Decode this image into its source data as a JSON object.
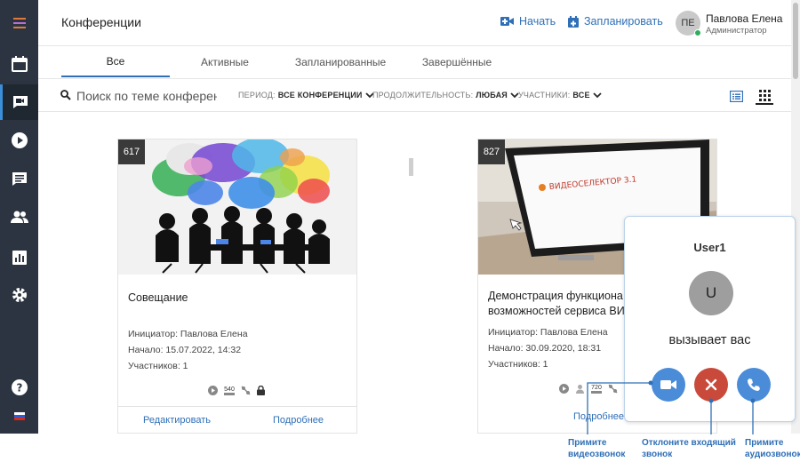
{
  "header": {
    "title": "Конференции",
    "start_label": "Начать",
    "schedule_label": "Запланировать",
    "user": {
      "initials": "ПЕ",
      "name": "Павлова Елена",
      "role": "Администратор"
    }
  },
  "tabs": [
    {
      "label": "Все",
      "active": true
    },
    {
      "label": "Активные"
    },
    {
      "label": "Запланированные"
    },
    {
      "label": "Завершённые"
    }
  ],
  "filters": {
    "search_placeholder": "Поиск по теме конференции",
    "period": {
      "label": "ПЕРИОД:",
      "value": "ВСЕ КОНФЕРЕНЦИИ"
    },
    "duration": {
      "label": "ПРОДОЛЖИТЕЛЬНОСТЬ:",
      "value": "ЛЮБАЯ"
    },
    "participants": {
      "label": "УЧАСТНИКИ:",
      "value": "ВСЕ"
    }
  },
  "cards": [
    {
      "badge": "617",
      "title": "Совещание",
      "initiator": "Инициатор: Павлова Елена",
      "start": "Начало: 15.07.2022, 14:32",
      "participants": "Участников: 1",
      "resolution": "540",
      "edit_label": "Редактировать",
      "details_label": "Подробнее"
    },
    {
      "badge": "827",
      "title_line1": "Демонстрация функциона",
      "title_line2": "возможностей сервиса ВИ",
      "initiator": "Инициатор: Павлова Елена",
      "start": "Начало: 30.09.2020, 18:31",
      "participants": "Участников: 1",
      "resolution": "720",
      "details_label": "Подробнее",
      "logo_text": "ВИДЕОСЕЛЕКТОР 3.1"
    }
  ],
  "call": {
    "caller": "User1",
    "avatar_initial": "U",
    "status": "вызывает вас"
  },
  "callouts": {
    "video_line1": "Примите",
    "video_line2": "видеозвонок",
    "decline_line1": "Отклоните входящий",
    "decline_line2": "звонок",
    "audio_line1": "Примите",
    "audio_line2": "аудиозвонок"
  },
  "colors": {
    "sidebar": "#2b3440",
    "accent": "#2f6fb7",
    "accept_button": "#4a8cd8",
    "decline_button": "#c94a3a"
  }
}
